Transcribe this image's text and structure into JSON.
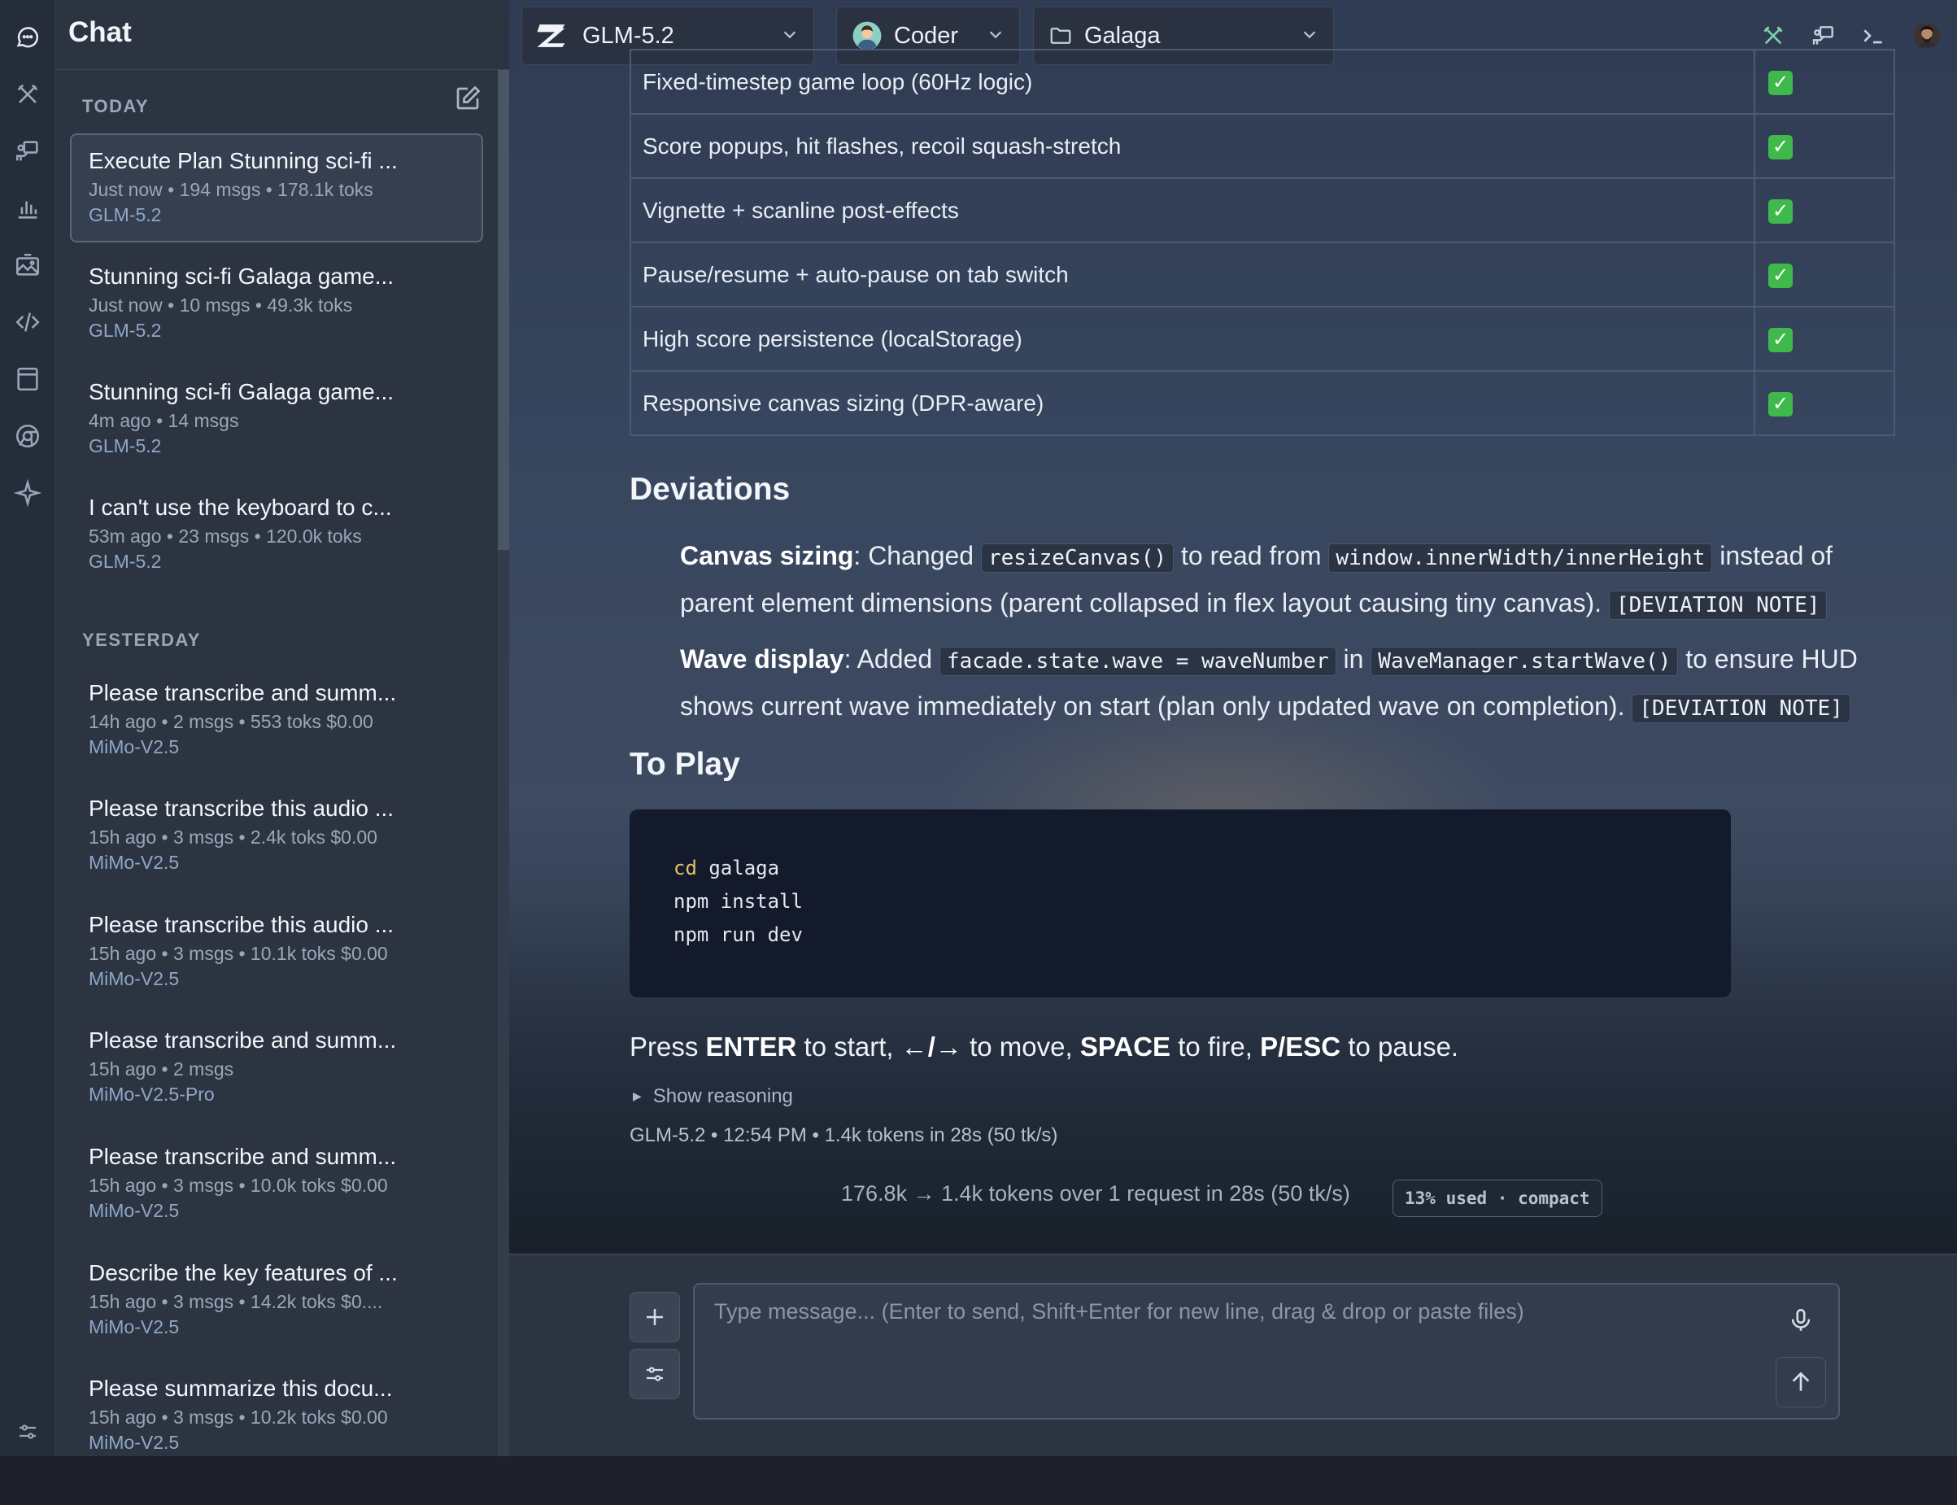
{
  "sidebar": {
    "title": "Chat",
    "sections": [
      {
        "label": "TODAY",
        "items": [
          {
            "title": "Execute Plan Stunning sci-fi ...",
            "meta": "Just now • 194 msgs • 178.1k toks",
            "model": "GLM-5.2"
          },
          {
            "title": "Stunning sci-fi Galaga game...",
            "meta": "Just now • 10 msgs • 49.3k toks",
            "model": "GLM-5.2"
          },
          {
            "title": "Stunning sci-fi Galaga game...",
            "meta": "4m ago • 14 msgs",
            "model": "GLM-5.2"
          },
          {
            "title": "I can't use the keyboard to c...",
            "meta": "53m ago • 23 msgs • 120.0k toks",
            "model": "GLM-5.2"
          }
        ]
      },
      {
        "label": "YESTERDAY",
        "items": [
          {
            "title": "Please transcribe and summ...",
            "meta": "14h ago • 2 msgs • 553 toks $0.00",
            "model": "MiMo-V2.5"
          },
          {
            "title": "Please transcribe this audio ...",
            "meta": "15h ago • 3 msgs • 2.4k toks $0.00",
            "model": "MiMo-V2.5"
          },
          {
            "title": "Please transcribe this audio ...",
            "meta": "15h ago • 3 msgs • 10.1k toks $0.00",
            "model": "MiMo-V2.5"
          },
          {
            "title": "Please transcribe and summ...",
            "meta": "15h ago • 2 msgs",
            "model": "MiMo-V2.5-Pro"
          },
          {
            "title": "Please transcribe and summ...",
            "meta": "15h ago • 3 msgs • 10.0k toks $0.00",
            "model": "MiMo-V2.5"
          },
          {
            "title": "Describe the key features of ...",
            "meta": "15h ago • 3 msgs • 14.2k toks $0....",
            "model": "MiMo-V2.5"
          },
          {
            "title": "Please summarize this docu...",
            "meta": "15h ago • 3 msgs • 10.2k toks $0.00",
            "model": "MiMo-V2.5"
          }
        ]
      }
    ]
  },
  "topbar": {
    "model": "GLM-5.2",
    "persona": "Coder",
    "project": "Galaga"
  },
  "checklist": [
    {
      "feature": "Fixed-timestep game loop (60Hz logic)",
      "status": "✓"
    },
    {
      "feature": "Score popups, hit flashes, recoil squash-stretch",
      "status": "✓"
    },
    {
      "feature": "Vignette + scanline post-effects",
      "status": "✓"
    },
    {
      "feature": "Pause/resume + auto-pause on tab switch",
      "status": "✓"
    },
    {
      "feature": "High score persistence (localStorage)",
      "status": "✓"
    },
    {
      "feature": "Responsive canvas sizing (DPR-aware)",
      "status": "✓"
    }
  ],
  "deviations": {
    "heading": "Deviations",
    "item1": {
      "label": "Canvas sizing",
      "t1": ": Changed ",
      "code1": "resizeCanvas()",
      "t2": " to read from ",
      "code2": "window.innerWidth/innerHeight",
      "t3": " instead of parent element dimensions (parent collapsed in flex layout causing tiny canvas). ",
      "note": "[DEVIATION NOTE]"
    },
    "item2": {
      "label": "Wave display",
      "t1": ": Added ",
      "code1": "facade.state.wave = waveNumber",
      "t2": " in ",
      "code2": "WaveManager.startWave()",
      "t3": " to ensure HUD shows current wave immediately on start (plan only updated wave on completion). ",
      "note": "[DEVIATION NOTE]"
    }
  },
  "to_play": {
    "heading": "To Play",
    "code": [
      {
        "kw": "cd",
        "rest": " galaga"
      },
      {
        "kw": "",
        "rest": "npm install"
      },
      {
        "kw": "",
        "rest": "npm run dev"
      }
    ]
  },
  "instructions": {
    "p1": "Press ",
    "k1": "ENTER",
    "p2": " to start, ",
    "k2": "←/→",
    "p3": " to move, ",
    "k3": "SPACE",
    "p4": " to fire, ",
    "k4": "P/ESC",
    "p5": " to pause."
  },
  "reasoning_toggle": "Show reasoning",
  "message_meta": "GLM-5.2 • 12:54 PM • 1.4k tokens in 28s (50 tk/s)",
  "usage": {
    "summary": "176.8k → 1.4k tokens over 1 request in 28s (50 tk/s)",
    "badge": "13% used · compact"
  },
  "composer": {
    "placeholder": "Type message... (Enter to send, Shift+Enter for new line, drag & drop or paste files)"
  }
}
